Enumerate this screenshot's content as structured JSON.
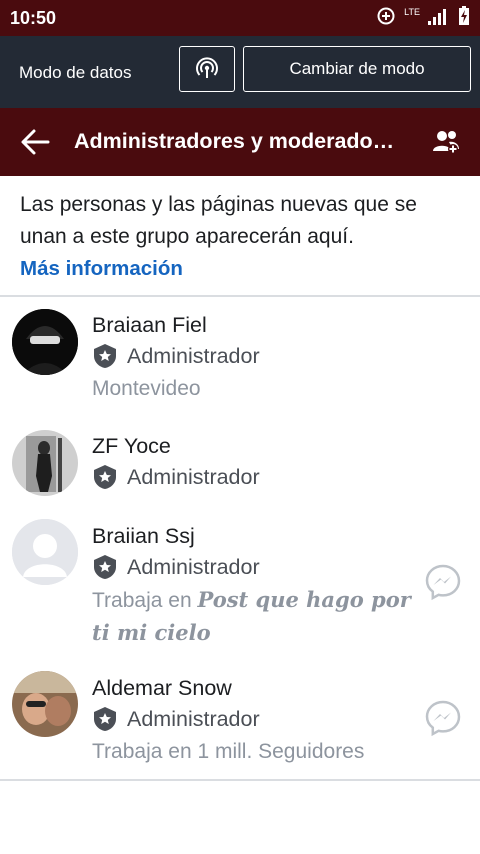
{
  "status": {
    "time": "10:50",
    "network": "LTE"
  },
  "data_mode": {
    "label": "Modo de datos",
    "switch_button": "Cambiar de modo"
  },
  "appbar": {
    "title": "Administradores y moderado…"
  },
  "info": {
    "text": "Las personas y las páginas nuevas que se unan a este grupo aparecerán aquí.",
    "link": "Más información"
  },
  "members": [
    {
      "name": "Braiaan Fiel",
      "role": "Administrador",
      "detail": "Montevideo"
    },
    {
      "name": "ZF Yoce",
      "role": "Administrador"
    },
    {
      "name": "Braiian Ssj",
      "role": "Administrador",
      "detail_prefix": "Trabaja en",
      "detail_fancy": "Post que hago por ti mi cielo"
    },
    {
      "name": "Aldemar Snow",
      "role": "Administrador",
      "detail": "Trabaja en 1 mill. Seguidores"
    }
  ],
  "colors": {
    "header": "#4a0b0e",
    "databar": "#232a35",
    "link": "#1565c0",
    "secondary_text": "#8d949e"
  }
}
